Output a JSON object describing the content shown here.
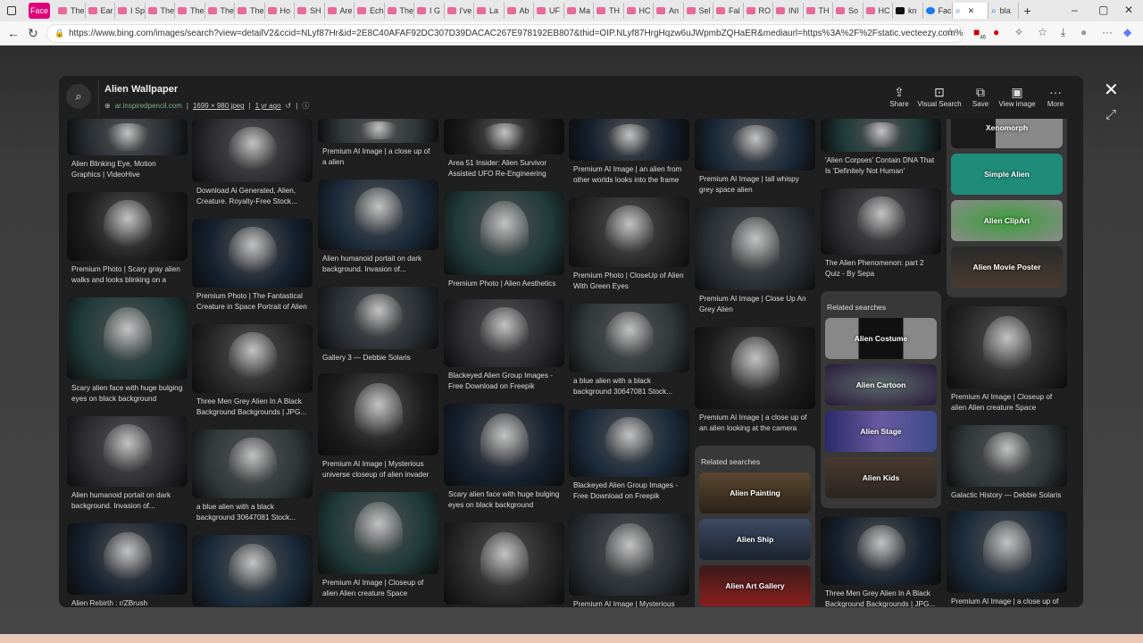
{
  "browser": {
    "tabs": [
      "Face",
      "The",
      "Ear",
      "I Sp",
      "The",
      "The",
      "The",
      "The",
      "Ho",
      "SH",
      "Are",
      "Ech",
      "The",
      "I G",
      "I've",
      "La",
      "Ab",
      "UF",
      "Ma",
      "TH",
      "HC",
      "An",
      "Sel",
      "Fal",
      "RO",
      "INI",
      "TH",
      "So",
      "HC",
      "kn",
      "Fac",
      "",
      "bla"
    ],
    "new_tab": "+",
    "url": "https://www.bing.com/images/search?view=detailV2&ccid=NLyf87Hr&id=2E8C40AFAF92DC307D39DACAC267E978192EB807&thid=OIP.NLyf87HrgHqzw6uJWpmbZQHaER&mediaurl=https%3A%2F%2Fstatic.vecteezy.com%2Fsystem%2...",
    "ext_badge": "46"
  },
  "detail": {
    "title": "Alien Wallpaper",
    "source": "ar.inspiredpencil.com",
    "dimensions": "1699 × 980 jpeg",
    "age": "1 yr ago",
    "sep": "|",
    "actions": [
      "Share",
      "Visual Search",
      "Save",
      "View image",
      "More"
    ]
  },
  "columns": [
    {
      "items": [
        "Alien Blinking Eye, Motion Graphics | VideoHive",
        "Premium Photo | Scary gray alien walks and looks blinking on a dar...",
        "Scary alien face with huge bulging eyes on black background closeu...",
        "Alien humanoid portait on dark background. Invasion of...",
        "Alien Rebirth : r/ZBrush"
      ]
    },
    {
      "items": [
        "Download Ai Generated, Alien, Creature. Royalty-Free Stock...",
        "Premium Photo | The Fantastical Creature in Space Portrait of Alien",
        "Three Men Grey Alien In A Black Background Backgrounds | JPG...",
        "a blue alien with a black background 30647081 Stock...",
        ""
      ]
    },
    {
      "items": [
        "Premium AI Image | a close up of a alien",
        "Alien humanoid portait on dark background. Invasion of...",
        "Gallery 3 — Debbie Solaris",
        "Premium AI Image | Mysterious universe closeup of alien invader",
        "Premium AI Image | Closeup of alien Alien creature Space dwelle..."
      ]
    },
    {
      "items": [
        "Area 51 Insider: Alien Survivor Assisted UFO Re-Engineering",
        "Premium Photo | Alien Aesthetics",
        "Blackeyed Alien Group Images - Free Download on Freepik",
        "Scary alien face with huge bulging eyes on black background closeu...",
        ""
      ]
    },
    {
      "items": [
        "Premium AI Image | an alien from other worlds looks into the frame",
        "Premium Photo | CloseUp of Alien With Green Eyes",
        "a blue alien with a black background 30647081 Stock...",
        "Blackeyed Alien Group Images - Free Download on Freepik",
        "Premium AI Image | Mysterious"
      ]
    },
    {
      "items": [
        "Premium AI Image | tall whispy grey space alien",
        "Premium AI Image | Close Up An Grey Alien",
        "Premium AI Image | a close up of an alien looking at the camera"
      ],
      "related": {
        "title": "Related searches",
        "items": [
          "Alien Painting",
          "Alien Ship",
          "Alien Art Gallery"
        ]
      }
    },
    {
      "items": [
        "'Alien Corpses' Contain DNA That Is 'Definitely Not Human'",
        "The Alien Phenomenon: part 2 Quiz - By Sepa",
        "Three Men Grey Alien In A Black Background Backgrounds | JPG..."
      ],
      "related": {
        "title": "Related searches",
        "items": [
          "Alien Costume",
          "Alien Cartoon",
          "Alien Stage",
          "Alien Kids"
        ]
      }
    },
    {
      "items": [
        "Premium AI Image | Closeup of alien Alien creature Space dwelle...",
        "Galactic History — Debbie Solaris",
        "Premium AI Image | a close up of"
      ],
      "related": {
        "title": "",
        "items": [
          "Xenomorph",
          "Simple Alien",
          "Alien ClipArt",
          "Alien Movie Poster"
        ]
      }
    }
  ]
}
